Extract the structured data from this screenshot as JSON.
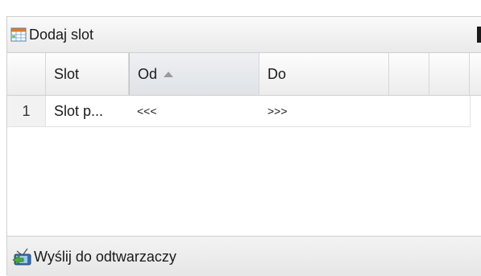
{
  "toolbar": {
    "add_slot_label": "Dodaj slot",
    "add_slot_icon": "grid-add-icon",
    "accent_color": "#e07a2a"
  },
  "grid": {
    "columns": [
      {
        "label": ""
      },
      {
        "label": "Slot"
      },
      {
        "label": "Od",
        "sort": "ascending"
      },
      {
        "label": "Do"
      },
      {
        "label": ""
      },
      {
        "label": ""
      }
    ],
    "rows": [
      {
        "num": "1",
        "slot": "Slot p...",
        "od": "<<<",
        "do": ">>>"
      }
    ]
  },
  "footer": {
    "send_label": "Wyślij do odtwarzaczy",
    "send_icon": "send-to-players-icon"
  }
}
